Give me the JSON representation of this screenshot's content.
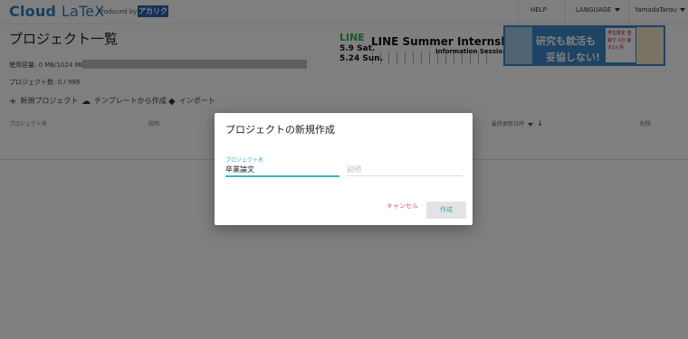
{
  "header": {
    "logo_cloud": "Cloud",
    "logo_latex": "LaTeX",
    "produced_by": "Produced by",
    "produced_brand": "アカリク",
    "help": "HELP",
    "language": "LANGUAGE",
    "user": "YamadaTarou"
  },
  "main": {
    "title": "プロジェクト一覧",
    "usage": "使用容量: 0 MB/1024 MB",
    "project_count": "プロジェクト数: 0 / 999"
  },
  "banners": {
    "line": {
      "logo": "LINE",
      "date1": "5.9 Sat.",
      "date2": "5.24 Sun.",
      "title": "LINE Summer Internship",
      "subtitle": "Information Session"
    },
    "acaric": {
      "text1": "研究も就活も",
      "text2": "妥協しない!",
      "small": "学生限定 登録で 1分 最大1ヶ月"
    }
  },
  "toolbar": {
    "new_project": "新規プロジェクト",
    "from_template": "テンプレートから作成",
    "import": "インポート"
  },
  "table": {
    "headers": [
      "プロジェクト名",
      "説明",
      "最終更新日時",
      "削除"
    ]
  },
  "dialog": {
    "title": "プロジェクトの新規作成",
    "name_label": "プロジェクト名",
    "name_value": "卒業論文",
    "description_placeholder": "説明",
    "cancel": "キャンセル",
    "create": "作成"
  },
  "colors": {
    "brand": "#2f7fc1",
    "accent": "#3bb3c3",
    "cancel": "#e05a73",
    "overlay": "rgba(0,0,0,0.5)"
  }
}
